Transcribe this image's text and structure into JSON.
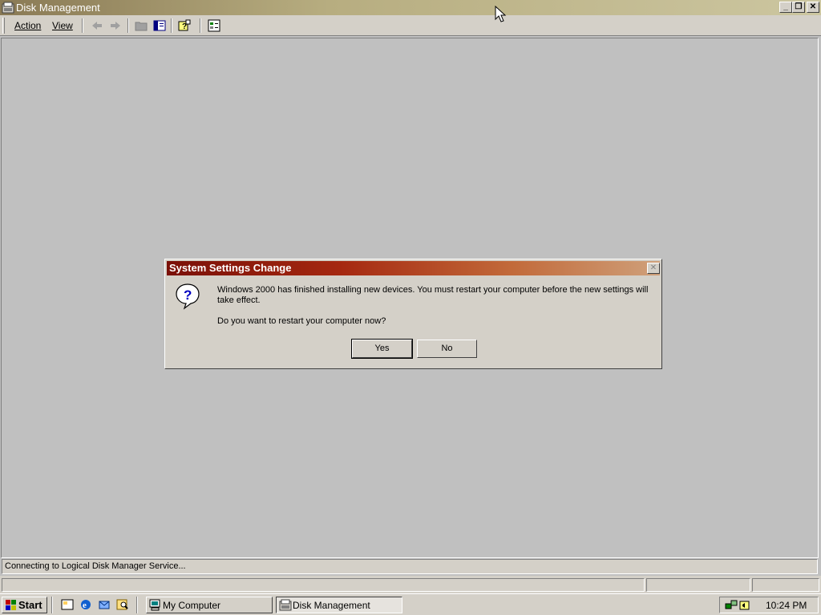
{
  "window": {
    "title": "Disk Management",
    "minimize_icon": "minimize-icon",
    "restore_icon": "restore-icon",
    "close_icon": "close-icon"
  },
  "menu": {
    "action": "Action",
    "view": "View"
  },
  "toolbar": {
    "icons": [
      "back-arrow-icon",
      "forward-arrow-icon",
      "folder-up-icon",
      "show-hide-tree-icon",
      "help-icon",
      "properties-icon"
    ]
  },
  "status": {
    "text": "Connecting to Logical Disk Manager Service..."
  },
  "dialog": {
    "title": "System Settings Change",
    "message": "Windows 2000 has finished installing new devices. You must restart your computer before the new settings will take effect.",
    "question": "Do you want to restart your computer now?",
    "yes_label": "Yes",
    "no_label": "No",
    "icon": "question-icon"
  },
  "taskbar": {
    "start_label": "Start",
    "quick_launch": [
      "show-desktop-icon",
      "internet-explorer-icon",
      "outlook-express-icon",
      "search-icon"
    ],
    "tasks": [
      {
        "label": "My Computer",
        "active": false
      },
      {
        "label": "Disk Management",
        "active": true
      }
    ],
    "clock": "10:24 PM",
    "tray_icons": [
      "network-icon",
      "volume-icon"
    ]
  },
  "colors": {
    "face": "#d4d0c8",
    "desktop": "#c0c0c0",
    "dialog_title_start": "#7a1008",
    "dialog_title_end": "#cfa07a"
  }
}
